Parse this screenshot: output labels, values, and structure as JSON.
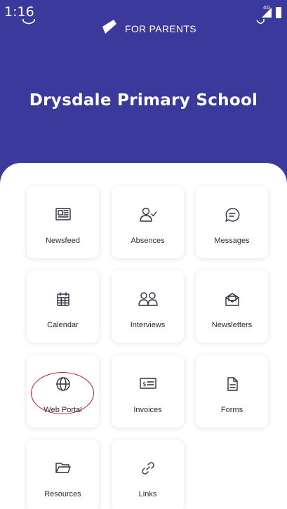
{
  "status": {
    "time": "1:16",
    "network": "4G"
  },
  "header": {
    "brand_label": "FOR PARENTS",
    "school_name": "Drysdale Primary School",
    "background": "#3b3a9c"
  },
  "tiles": [
    {
      "label": "Newsfeed",
      "icon": "newspaper-icon"
    },
    {
      "label": "Absences",
      "icon": "user-check-icon"
    },
    {
      "label": "Messages",
      "icon": "chat-bubble-icon"
    },
    {
      "label": "Calendar",
      "icon": "calendar-icon"
    },
    {
      "label": "Interviews",
      "icon": "users-icon"
    },
    {
      "label": "Newsletters",
      "icon": "envelope-icon"
    },
    {
      "label": "Web Portal",
      "icon": "globe-icon"
    },
    {
      "label": "Invoices",
      "icon": "invoice-icon"
    },
    {
      "label": "Forms",
      "icon": "document-icon"
    },
    {
      "label": "Resources",
      "icon": "folder-icon"
    },
    {
      "label": "Links",
      "icon": "link-icon"
    }
  ],
  "annotation": {
    "highlighted_tile": "Web Portal",
    "color": "#c41e2a"
  }
}
